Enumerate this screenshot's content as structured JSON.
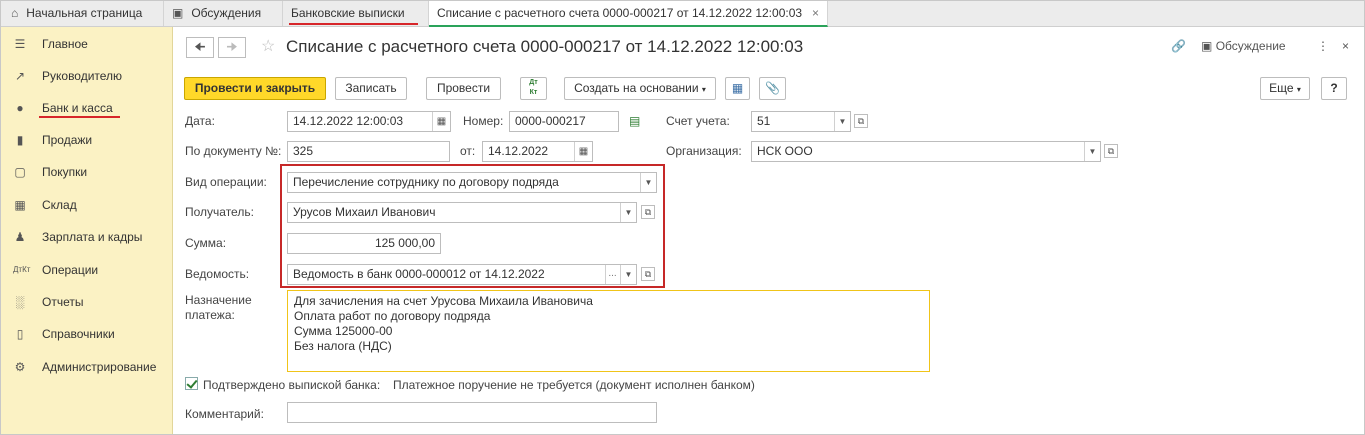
{
  "tabs": {
    "home": "Начальная страница",
    "discussions": "Обсуждения",
    "bank": "Банковские выписки",
    "doc": "Списание с расчетного счета 0000-000217 от 14.12.2022 12:00:03"
  },
  "sidebar": {
    "items": [
      {
        "label": "Главное",
        "icon": "menu-icon"
      },
      {
        "label": "Руководителю",
        "icon": "trend-icon"
      },
      {
        "label": "Банк и касса",
        "icon": "coin-icon"
      },
      {
        "label": "Продажи",
        "icon": "bag-icon"
      },
      {
        "label": "Покупки",
        "icon": "cart-icon"
      },
      {
        "label": "Склад",
        "icon": "warehouse-icon"
      },
      {
        "label": "Зарплата и кадры",
        "icon": "person-icon"
      },
      {
        "label": "Операции",
        "icon": "dt-kt-icon"
      },
      {
        "label": "Отчеты",
        "icon": "bar-chart-icon"
      },
      {
        "label": "Справочники",
        "icon": "book-icon"
      },
      {
        "label": "Администрирование",
        "icon": "gear-icon"
      }
    ]
  },
  "header": {
    "title": "Списание с расчетного счета 0000-000217 от 14.12.2022 12:00:03",
    "discussion": "Обсуждение"
  },
  "toolbar": {
    "post_close": "Провести и закрыть",
    "save": "Записать",
    "post": "Провести",
    "create_based": "Создать на основании",
    "more": "Еще",
    "help": "?"
  },
  "form": {
    "date_label": "Дата:",
    "date_value": "14.12.2022 12:00:03",
    "number_label": "Номер:",
    "number_value": "0000-000217",
    "account_label": "Счет учета:",
    "account_value": "51",
    "bydoc_label": "По документу №:",
    "bydoc_value": "325",
    "from_label": "от:",
    "from_value": "14.12.2022",
    "org_label": "Организация:",
    "org_value": "НСК ООО",
    "optype_label": "Вид операции:",
    "optype_value": "Перечисление сотруднику по договору подряда",
    "recipient_label": "Получатель:",
    "recipient_value": "Урусов Михаил Иванович",
    "sum_label": "Сумма:",
    "sum_value": "125 000,00",
    "statement_label": "Ведомость:",
    "statement_value": "Ведомость в банк 0000-000012 от 14.12.2022",
    "purpose_label_1": "Назначение",
    "purpose_label_2": "платежа:",
    "purpose_lines": [
      "Для зачисления на счет Урусова Михаила Ивановича",
      "Оплата работ по договору подряда",
      "Сумма 125000-00",
      "Без налога (НДС)"
    ],
    "confirmed_label": "Подтверждено выпиской банка:",
    "confirmed_checked": true,
    "payment_note": "Платежное поручение не требуется (документ исполнен банком)",
    "comment_label": "Комментарий:",
    "comment_value": ""
  }
}
